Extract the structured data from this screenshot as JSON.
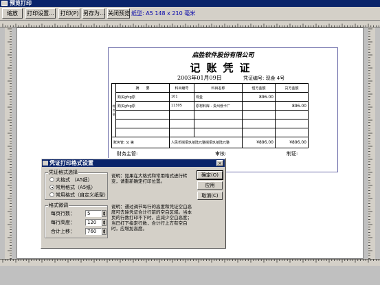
{
  "window": {
    "title": "预览打印"
  },
  "toolbar": {
    "zoom": "缩放",
    "print_setup": "打印设置...",
    "print": "打印(P)",
    "save_as": "另存为...",
    "close_preview": "关闭预览",
    "paper_info": "纸型: A5 148 x 210 毫米"
  },
  "voucher": {
    "company": "启胜软件股份有限公司",
    "title": "记账凭证",
    "date": "2003年01月09日",
    "voucher_no": "凭证编号: 现金 4号",
    "side_label": "附件张",
    "columns": {
      "summary": "摘　　要",
      "subject_code": "科目编号",
      "subject_name": "科目名称",
      "debit": "借方金额",
      "credit": "贷方金额"
    },
    "rows": [
      {
        "summary": "购买gfcg原",
        "code": "101",
        "name": "现金",
        "debit": "896.00",
        "credit": ""
      },
      {
        "summary": "购买gfcg原",
        "code": "11305",
        "name": "原材料库 - 贵州低卡厂",
        "debit": "",
        "credit": "896.00"
      },
      {
        "summary": "",
        "code": "",
        "name": "",
        "debit": "",
        "credit": ""
      },
      {
        "summary": "",
        "code": "",
        "name": "",
        "debit": "",
        "credit": ""
      },
      {
        "summary": "",
        "code": "",
        "name": "",
        "debit": "",
        "credit": ""
      }
    ],
    "total_label": "账务管: 又 第",
    "total_words": "人民币捌佰玖拾陆元整捌佰玖拾陆元整",
    "total_debit": "¥896.00",
    "total_credit": "¥896.00",
    "sign_supervisor": "财务主管:",
    "sign_audit": "审核:",
    "sign_maker": "制证:"
  },
  "dialog": {
    "title": "凭证打印格式设置",
    "close": "×",
    "format_group": "凭证格式选择",
    "radio_large": "大格式 （A5纸）",
    "radio_common": "常用格式（A5纸）",
    "radio_custom": "常用格式（自定义纸型）",
    "desc1": "说明：如果在大格式和常用格式进行转变，请重新确定打印位置。",
    "fine_group": "格式微调",
    "rows_label": "每页行数：",
    "rows_value": "5",
    "height_label": "每行高度：",
    "height_value": "120",
    "offset_label": "合计上移：",
    "offset_value": "760",
    "desc2": "说明：通过调节每行的高度和凭证空白高度可去除凭证合计行前的空白区域。当本页的行数打印不下时，应减少空白高度；当已打下指定行数，合计行上方有空白时，应增加高度。",
    "ok": "确定(O)",
    "apply": "应用",
    "cancel": "取消(C)"
  }
}
